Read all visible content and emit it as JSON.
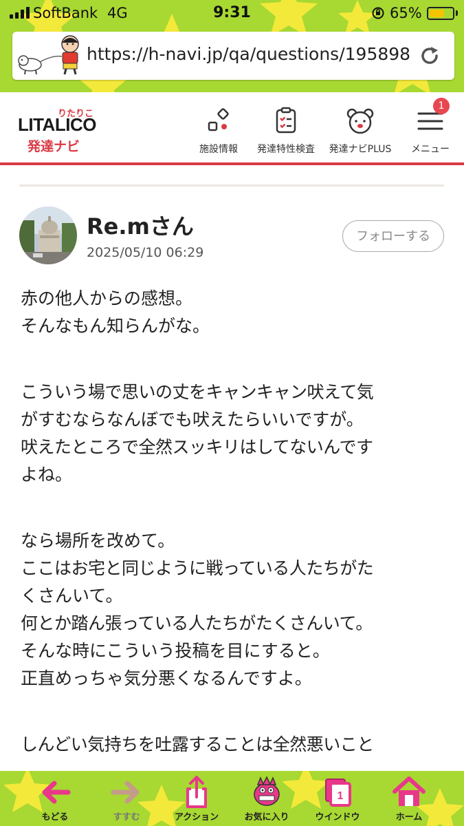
{
  "status_bar": {
    "carrier": "SoftBank",
    "network": "4G",
    "time": "9:31",
    "battery": "65%",
    "battery_level": 0.65
  },
  "browser": {
    "url": "https://h-navi.jp/qa/questions/195898",
    "reload_icon": "reload-icon",
    "mascot_icon": "mascot-walking-dog"
  },
  "site_header": {
    "logo_ruby": "りたりこ",
    "logo_main": "LITALICO",
    "logo_sub": "発達ナビ",
    "nav": [
      {
        "label": "施設情報",
        "icon": "facility-icon"
      },
      {
        "label": "発達特性検査",
        "icon": "clipboard-icon"
      },
      {
        "label": "発達ナビPLUS",
        "icon": "bear-icon"
      },
      {
        "label": "メニュー",
        "icon": "hamburger-icon"
      }
    ],
    "menu_badge": "1",
    "accent_color": "#d93a45"
  },
  "post": {
    "user_name": "Re.mさん",
    "date": "2025/05/10 06:29",
    "follow_label": "フォローする",
    "lines": [
      "赤の他人からの感想。",
      "そんなもん知らんがな。",
      "",
      "こういう場で思いの丈をキャンキャン吠えて気",
      "がすむならなんぼでも吠えたらいいですが。",
      "吠えたところで全然スッキリはしてないんです",
      "よね。",
      "",
      "なら場所を改めて。",
      "ここはお宅と同じように戦っている人たちがた",
      "くさんいて。",
      "何とか踏ん張っている人たちがたくさんいて。",
      "そんな時にこういう投稿を目にすると。",
      "正直めっちゃ気分悪くなるんですよ。",
      "",
      "しんどい気持ちを吐露することは全然悪いこと"
    ]
  },
  "toolbar": {
    "items": [
      {
        "label": "もどる",
        "icon": "back-arrow-icon",
        "enabled": true
      },
      {
        "label": "すすむ",
        "icon": "forward-arrow-icon",
        "enabled": false
      },
      {
        "label": "アクション",
        "icon": "share-icon",
        "enabled": true
      },
      {
        "label": "お気に入り",
        "icon": "favorites-character-icon",
        "enabled": true
      },
      {
        "label": "ウインドウ",
        "icon": "windows-icon",
        "enabled": true,
        "count": "1"
      },
      {
        "label": "ホーム",
        "icon": "home-icon",
        "enabled": true
      }
    ],
    "background_color": "#a8d832"
  }
}
